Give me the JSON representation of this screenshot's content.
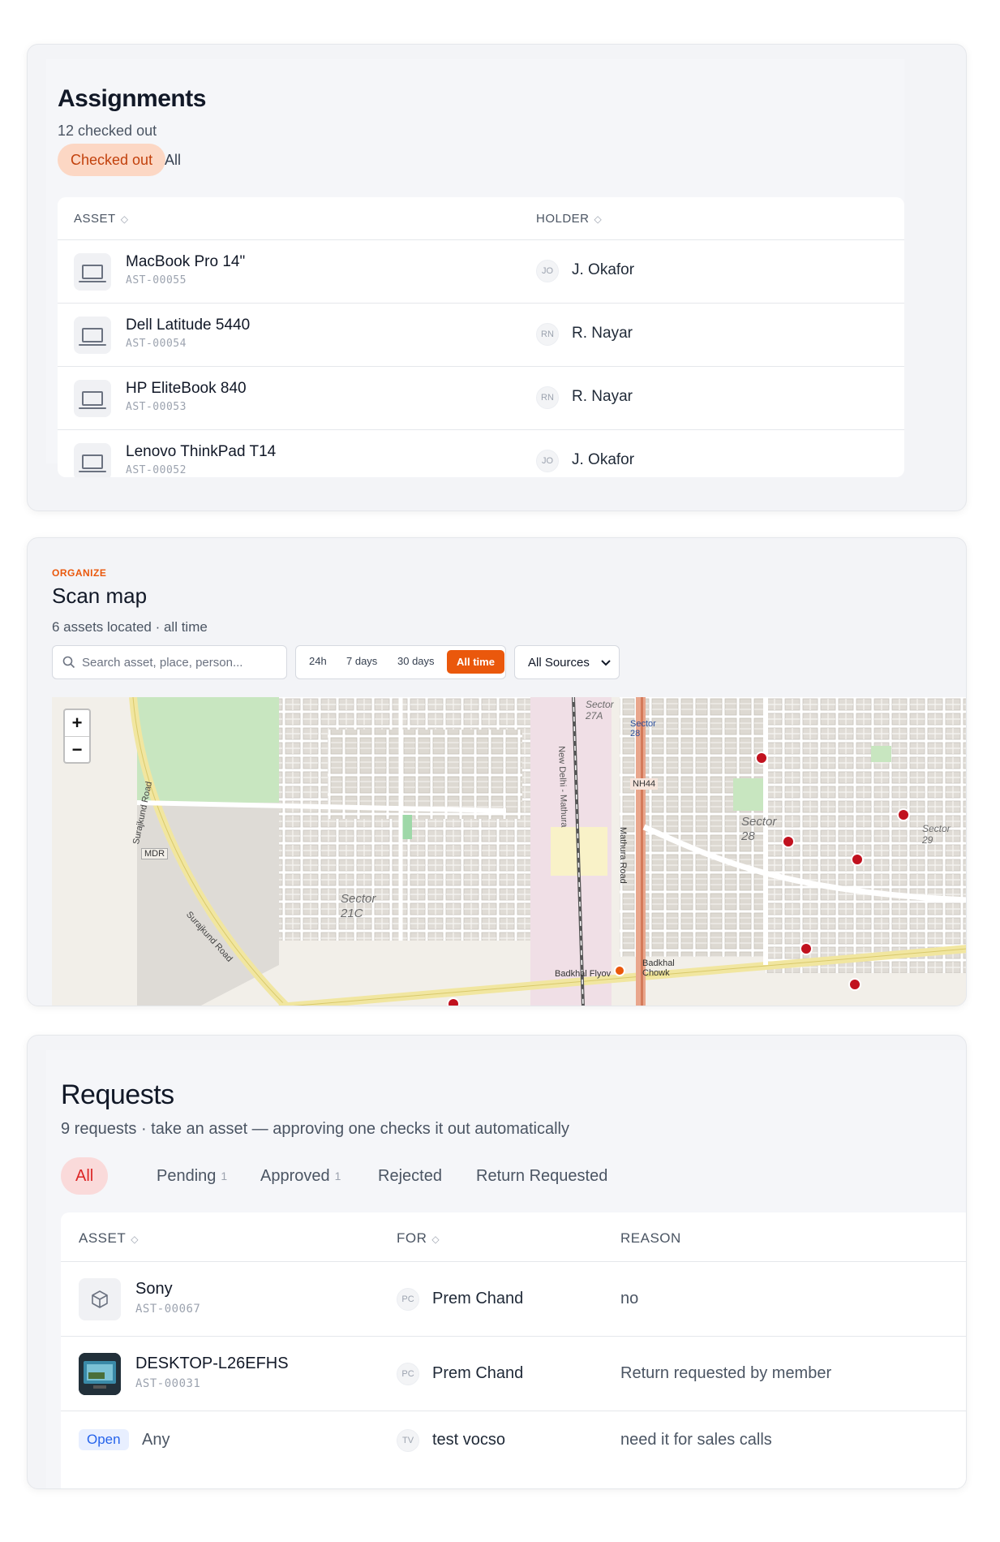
{
  "assignments": {
    "title": "Assignments",
    "subtitle": "12 checked out",
    "filters": [
      "Checked out",
      "All"
    ],
    "columns": {
      "asset": "ASSET",
      "holder": "HOLDER"
    },
    "rows": [
      {
        "name": "MacBook Pro 14\"",
        "code": "AST-00055",
        "initials": "JO",
        "holder": "J. Okafor"
      },
      {
        "name": "Dell Latitude 5440",
        "code": "AST-00054",
        "initials": "RN",
        "holder": "R. Nayar"
      },
      {
        "name": "HP EliteBook 840",
        "code": "AST-00053",
        "initials": "RN",
        "holder": "R. Nayar"
      },
      {
        "name": "Lenovo ThinkPad T14",
        "code": "AST-00052",
        "initials": "JO",
        "holder": "J. Okafor"
      }
    ]
  },
  "scanmap": {
    "eyebrow": "ORGANIZE",
    "title": "Scan map",
    "subtitle": "6 assets located · all time",
    "search_placeholder": "Search asset, place, person...",
    "ranges": [
      "24h",
      "7 days",
      "30 days",
      "All time"
    ],
    "source_select": "All Sources",
    "map_labels": {
      "sector27a": "Sector 27A",
      "sector28a": "Sector 28",
      "sector28b": "Sector 28",
      "sector29": "Sector 29",
      "sector21c": "Sector 21C",
      "nh44": "NH44",
      "mathura": "Mathura Road",
      "newdelhi": "New Delhi - Mathura",
      "surajkund1": "Surajkund Road",
      "surajkund2": "Surajkund Road",
      "mdr": "MDR",
      "badkhal": "Badkhal Flyov",
      "chowk": "Badkhal Chowk"
    },
    "zoom_in": "+",
    "zoom_out": "−"
  },
  "requests": {
    "title": "Requests",
    "subtitle": "9 requests · take an asset — approving one checks it out automatically",
    "tabs": [
      {
        "label": "All",
        "count": ""
      },
      {
        "label": "Pending",
        "count": "1"
      },
      {
        "label": "Approved",
        "count": "1"
      },
      {
        "label": "Rejected",
        "count": ""
      },
      {
        "label": "Return Requested",
        "count": ""
      }
    ],
    "columns": {
      "asset": "ASSET",
      "for": "FOR",
      "reason": "REASON"
    },
    "rows": [
      {
        "name": "Sony",
        "code": "AST-00067",
        "initials": "PC",
        "for": "Prem Chand",
        "reason": "no"
      },
      {
        "name": "DESKTOP-L26EFHS",
        "code": "AST-00031",
        "initials": "PC",
        "for": "Prem Chand",
        "reason": "Return requested by member"
      },
      {
        "badge": "Open",
        "name": "Any",
        "initials": "TV",
        "for": "test vocso",
        "reason": "need it for sales calls"
      }
    ]
  }
}
